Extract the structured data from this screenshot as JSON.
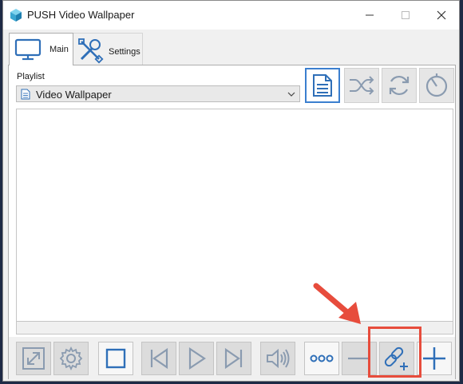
{
  "window": {
    "title": "PUSH Video Wallpaper"
  },
  "tabs": [
    {
      "label": "Main",
      "icon": "monitor-icon",
      "active": true
    },
    {
      "label": "Settings",
      "icon": "tools-icon",
      "active": false
    }
  ],
  "playlist": {
    "label": "Playlist",
    "selected": "Video Wallpaper"
  },
  "top_toolbar": [
    {
      "name": "playlist-mode",
      "icon": "document-icon",
      "active": true
    },
    {
      "name": "shuffle",
      "icon": "shuffle-icon",
      "active": false
    },
    {
      "name": "repeat",
      "icon": "refresh-icon",
      "active": false
    },
    {
      "name": "timer",
      "icon": "timer-icon",
      "active": false
    }
  ],
  "bottom_toolbar": [
    {
      "name": "fullscreen",
      "icon": "expand-icon"
    },
    {
      "name": "settings",
      "icon": "gear-icon"
    },
    {
      "name": "stop",
      "icon": "stop-icon"
    },
    {
      "name": "previous",
      "icon": "skip-back-icon"
    },
    {
      "name": "play",
      "icon": "play-icon"
    },
    {
      "name": "next",
      "icon": "skip-forward-icon"
    },
    {
      "name": "volume",
      "icon": "speaker-icon"
    },
    {
      "name": "more",
      "icon": "ellipsis-icon"
    },
    {
      "name": "remove",
      "icon": "minus-icon"
    },
    {
      "name": "add-url",
      "icon": "link-add-icon"
    },
    {
      "name": "add",
      "icon": "plus-icon"
    }
  ],
  "colors": {
    "accent": "#3b7fcf",
    "highlight": "#e74c3c",
    "icon_gray": "#8a9bb0"
  }
}
